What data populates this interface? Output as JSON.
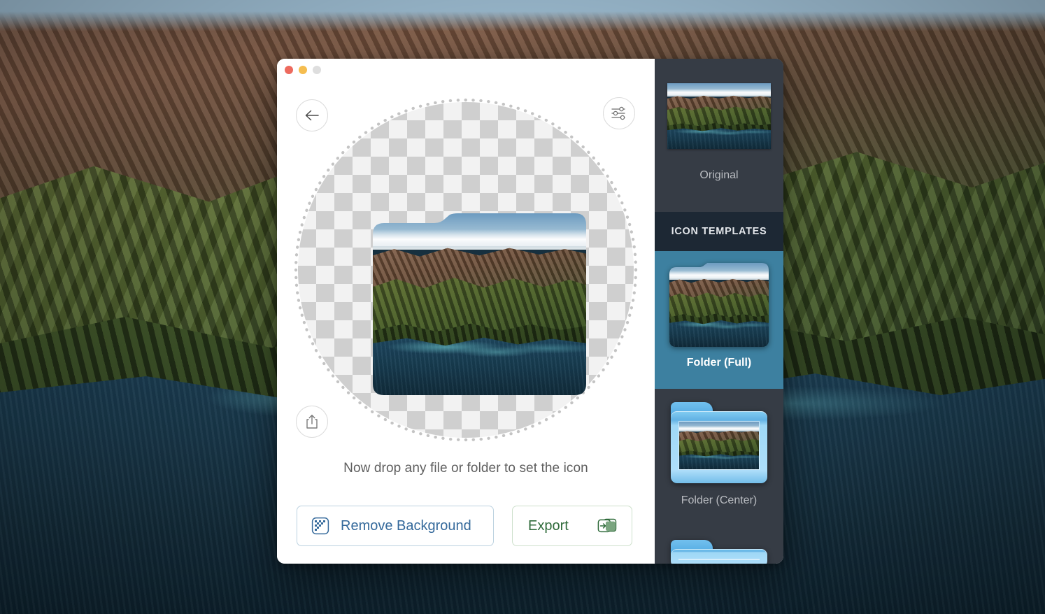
{
  "window": {
    "traffic_lights": [
      {
        "name": "close",
        "color": "#ed6a5e"
      },
      {
        "name": "minimize",
        "color": "#f5bd4f"
      },
      {
        "name": "zoom",
        "color": "#dedede"
      }
    ]
  },
  "toolbar": {
    "back_icon": "arrow-left-icon",
    "settings_icon": "sliders-icon",
    "share_icon": "share-icon"
  },
  "preview": {
    "drop_hint": "Now drop any file or folder to set the icon",
    "transparency_pattern": "checkerboard",
    "selection_ring": "dotted-circle"
  },
  "actions": {
    "remove_background": {
      "label": "Remove Background",
      "icon": "checkerboard-triangle-icon",
      "text_color": "#34699b",
      "border_color": "#bcd2e0"
    },
    "export": {
      "label": "Export",
      "icon": "export-arrow-icon",
      "text_color": "#2f6b3a",
      "border_color": "#cde0cb"
    }
  },
  "sidebar": {
    "original": {
      "label": "Original",
      "thumbnail": "big-sur-coastline"
    },
    "section_header": "ICON TEMPLATES",
    "templates": [
      {
        "label": "Folder (Full)",
        "selected": true,
        "style": "full"
      },
      {
        "label": "Folder (Center)",
        "selected": false,
        "style": "center"
      },
      {
        "label": "",
        "selected": false,
        "style": "center"
      }
    ],
    "accent_color": "#3d80a0",
    "background_color": "#363c45",
    "header_background": "#1d2834"
  }
}
